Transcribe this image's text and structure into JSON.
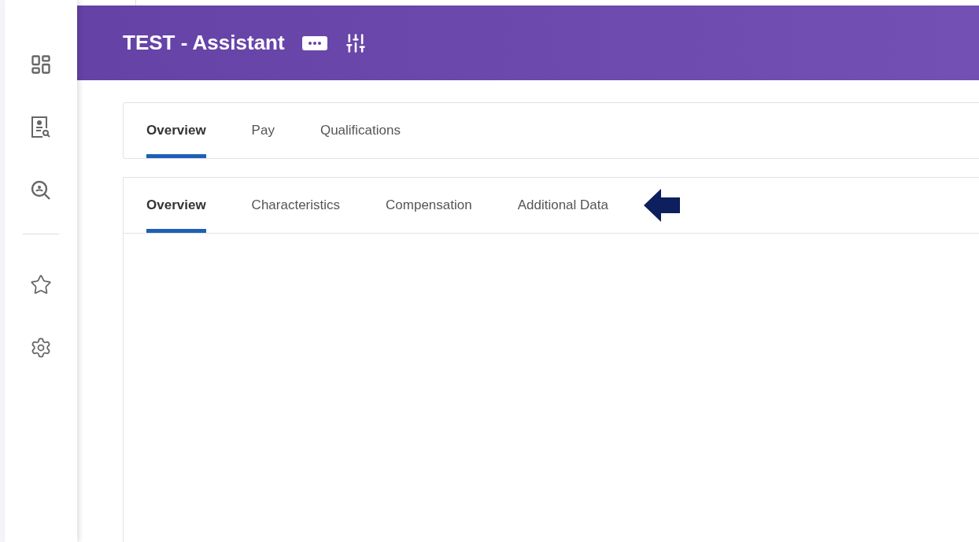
{
  "header": {
    "title": "TEST - Assistant"
  },
  "tabs": [
    {
      "label": "Overview",
      "selected": true
    },
    {
      "label": "Pay",
      "selected": false
    },
    {
      "label": "Qualifications",
      "selected": false
    }
  ],
  "subtabs": [
    {
      "label": "Overview",
      "selected": true
    },
    {
      "label": "Characteristics",
      "selected": false
    },
    {
      "label": "Compensation",
      "selected": false
    },
    {
      "label": "Additional Data",
      "selected": false
    }
  ]
}
